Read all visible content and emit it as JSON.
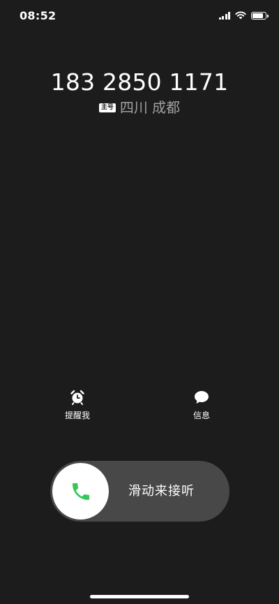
{
  "status_bar": {
    "time": "08:52",
    "battery_level": 0.85
  },
  "caller": {
    "number": "183 2850 1171",
    "sim_badge": "主号",
    "location": "四川 成都"
  },
  "actions": [
    {
      "label": "提醒我",
      "icon": "alarm-clock-icon"
    },
    {
      "label": "信息",
      "icon": "message-bubble-icon"
    }
  ],
  "slider": {
    "label": "滑动来接听",
    "icon": "phone-icon",
    "accent": "#34c759"
  },
  "colors": {
    "background": "#1c1c1c",
    "slider_track": "#484848",
    "secondary_text": "#a0a0a0"
  }
}
